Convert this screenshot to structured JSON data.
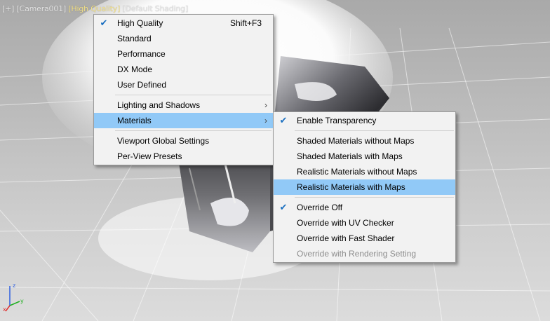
{
  "viewport": {
    "label_parts": [
      "[+]",
      "[Camera001]",
      "[High Quality]",
      "[Default Shading]"
    ]
  },
  "main_menu": {
    "items": [
      {
        "label": "High Quality",
        "checked": true,
        "shortcut": "Shift+F3"
      },
      {
        "label": "Standard"
      },
      {
        "label": "Performance"
      },
      {
        "label": "DX Mode"
      },
      {
        "label": "User Defined"
      },
      {
        "label": "Lighting and Shadows",
        "submenu": true
      },
      {
        "label": "Materials",
        "submenu": true,
        "highlighted": true
      },
      {
        "label": "Viewport Global Settings"
      },
      {
        "label": "Per-View Presets"
      }
    ]
  },
  "materials_menu": {
    "items": [
      {
        "label": "Enable Transparency",
        "checked": true
      },
      {
        "label": "Shaded Materials without Maps"
      },
      {
        "label": "Shaded Materials with Maps"
      },
      {
        "label": "Realistic Materials without Maps"
      },
      {
        "label": "Realistic Materials with Maps",
        "highlighted": true
      },
      {
        "label": "Override Off",
        "checked": true
      },
      {
        "label": "Override with UV Checker"
      },
      {
        "label": "Override with Fast Shader"
      },
      {
        "label": "Override with Rendering Setting",
        "disabled": true
      }
    ]
  },
  "icons": {
    "check": "checkmark-icon",
    "submenu": "submenu-arrow-icon",
    "axis": "axis-tripod-icon"
  },
  "colors": {
    "highlight": "#91c9f7",
    "check": "#1a6fc0",
    "active_label": "#f5e38a",
    "axis_x": "#e03030",
    "axis_y": "#20b020",
    "axis_z": "#3060e0"
  }
}
